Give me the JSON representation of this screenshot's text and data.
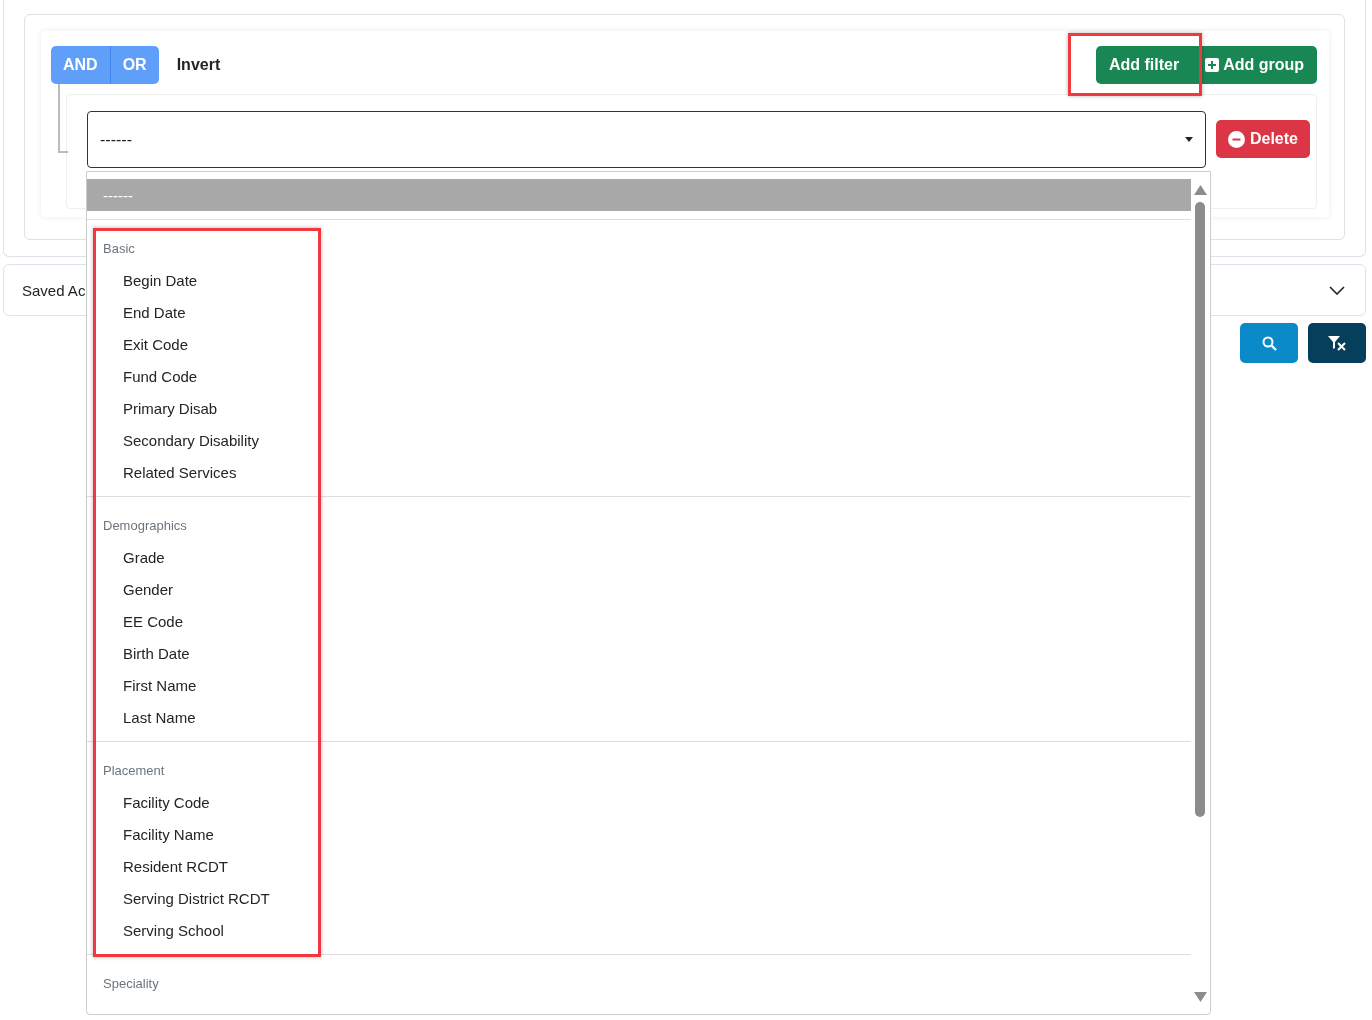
{
  "query": {
    "conjunctions": [
      "AND",
      "OR"
    ],
    "invert": "Invert",
    "actions": [
      {
        "kind": "plain",
        "label": "Add filter"
      },
      {
        "kind": "add",
        "label": "Add group"
      }
    ]
  },
  "rule": {
    "field": {
      "value": "------"
    },
    "delete": "Delete"
  },
  "dropdown": {
    "options": [
      {
        "label": "------",
        "selected": true
      }
    ],
    "groups": [
      {
        "label": "Basic",
        "items": [
          {
            "label": "Begin Date",
            "selected": false
          },
          {
            "label": "End Date",
            "selected": false
          },
          {
            "label": "Exit Code",
            "selected": false
          },
          {
            "label": "Fund Code",
            "selected": false
          },
          {
            "label": "Primary Disab",
            "selected": false
          },
          {
            "label": "Secondary Disability",
            "selected": false
          },
          {
            "label": "Related Services",
            "selected": false
          }
        ]
      },
      {
        "label": "Demographics",
        "items": [
          {
            "label": "Grade",
            "selected": false
          },
          {
            "label": "Gender",
            "selected": false
          },
          {
            "label": "EE Code",
            "selected": false
          },
          {
            "label": "Birth Date",
            "selected": false
          },
          {
            "label": "First Name",
            "selected": false
          },
          {
            "label": "Last Name",
            "selected": false
          }
        ]
      },
      {
        "label": "Placement",
        "items": [
          {
            "label": "Facility Code",
            "selected": false
          },
          {
            "label": "Facility Name",
            "selected": false
          },
          {
            "label": "Resident RCDT",
            "selected": false
          },
          {
            "label": "Serving District RCDT",
            "selected": false
          },
          {
            "label": "Serving School",
            "selected": false
          }
        ]
      },
      {
        "label": "Speciality"
      }
    ]
  },
  "saved_panel": {
    "title": "Saved Ac"
  }
}
